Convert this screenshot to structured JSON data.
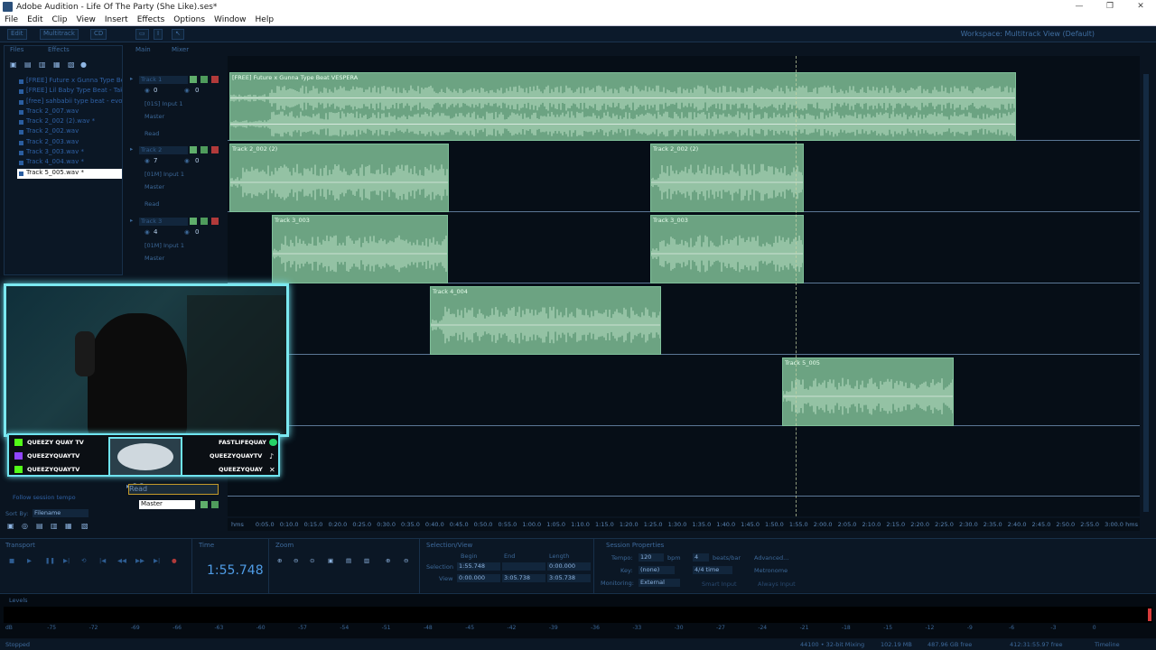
{
  "window": {
    "title": "Adobe Audition - Life Of The Party (She Like).ses*"
  },
  "menu": [
    "File",
    "Edit",
    "Clip",
    "View",
    "Insert",
    "Effects",
    "Options",
    "Window",
    "Help"
  ],
  "toolbar": {
    "edit": "Edit",
    "multitrack": "Multitrack",
    "cd": "CD",
    "workspace_label": "Workspace:",
    "workspace_value": "Multitrack View (Default)"
  },
  "left_panel": {
    "tabs": [
      "Files",
      "Effects"
    ],
    "files": [
      "[FREE] Future x Gunna Type Be",
      "[FREE] Lil Baby Type Beat - Tak",
      "[free] sahbabii type beat - evolvin",
      "Track 2_007.wav",
      "Track 2_002 (2).wav *",
      "Track 2_002.wav",
      "Track 2_003.wav",
      "Track 3_003.wav *",
      "Track 4_004.wav *",
      "Track 5_005.wav *"
    ],
    "follow_tempo": "Follow session tempo",
    "sort_label": "Sort By:",
    "sort_value": "Filename"
  },
  "main_tabs": [
    "Main",
    "Mixer"
  ],
  "tracks": [
    {
      "name": "Track 1",
      "vol": "0",
      "pan": "0",
      "input": "[01S] Input 1",
      "output": "Master",
      "auto": "Read"
    },
    {
      "name": "Track 2",
      "vol": "7",
      "pan": "0",
      "input": "[01M] Input 1",
      "output": "Master",
      "auto": "Read"
    },
    {
      "name": "Track 3",
      "vol": "4",
      "pan": "0",
      "input": "[01M] Input 1",
      "output": "Master",
      "auto": "Read"
    }
  ],
  "master_track": {
    "name": "Master",
    "vol": "0",
    "pan": "0",
    "auto": "Read"
  },
  "clips": [
    "[FREE] Future x Gunna Type Beat VESPERA",
    "Track 2_002 (2)",
    "Track 2_002 (2)",
    "Track 3_003",
    "Track 3_003",
    "Track 4_004",
    "Track 5_005"
  ],
  "ruler": [
    "hms",
    "0:05.0",
    "0:10.0",
    "0:15.0",
    "0:20.0",
    "0:25.0",
    "0:30.0",
    "0:35.0",
    "0:40.0",
    "0:45.0",
    "0:50.0",
    "0:55.0",
    "1:00.0",
    "1:05.0",
    "1:10.0",
    "1:15.0",
    "1:20.0",
    "1:25.0",
    "1:30.0",
    "1:35.0",
    "1:40.0",
    "1:45.0",
    "1:50.0",
    "1:55.0",
    "2:00.0",
    "2:05.0",
    "2:10.0",
    "2:15.0",
    "2:20.0",
    "2:25.0",
    "2:30.0",
    "2:35.0",
    "2:40.0",
    "2:45.0",
    "2:50.0",
    "2:55.0",
    "3:00.0",
    "hms"
  ],
  "overlay": {
    "left": [
      "QUEEZY QUAY TV",
      "QUEEZYQUAYTV",
      "QUEEZYQUAYTV"
    ],
    "right": [
      "FASTLIFEQUAY",
      "QUEEZYQUAYTV",
      "QUEEZYQUAY"
    ]
  },
  "transport": {
    "title": "Transport"
  },
  "time": {
    "title": "Time",
    "value": "1:55.748"
  },
  "zoom": {
    "title": "Zoom"
  },
  "selection": {
    "title": "Selection/View",
    "begin": "Begin",
    "end": "End",
    "length": "Length",
    "sel_label": "Selection",
    "view_label": "View",
    "sel_begin": "1:55.748",
    "sel_end": "",
    "sel_length": "0:00.000",
    "view_begin": "0:00.000",
    "view_end": "3:05.738",
    "view_length": "3:05.738"
  },
  "session": {
    "title": "Session Properties",
    "tempo_label": "Tempo:",
    "tempo": "120",
    "bpm": "bpm",
    "beats": "4",
    "beats_label": "beats/bar",
    "advanced": "Advanced...",
    "key_label": "Key:",
    "key": "(none)",
    "time_sig": "4/4 time",
    "metronome": "Metronome",
    "monitoring_label": "Monitoring:",
    "monitoring": "External",
    "smart_input": "Smart Input",
    "always_input": "Always Input"
  },
  "levels": {
    "title": "Levels",
    "scale": [
      "dB",
      "-75",
      "-72",
      "-69",
      "-66",
      "-63",
      "-60",
      "-57",
      "-54",
      "-51",
      "-48",
      "-45",
      "-42",
      "-39",
      "-36",
      "-33",
      "-30",
      "-27",
      "-24",
      "-21",
      "-18",
      "-15",
      "-12",
      "-9",
      "-6",
      "-3",
      "0"
    ]
  },
  "status": {
    "left": "Stopped",
    "sample": "44100 • 32-bit Mixing",
    "mem": "102.19 MB",
    "disk": "487.96 GB free",
    "time": "412:31:55.97 free",
    "timeline": "Timeline"
  }
}
